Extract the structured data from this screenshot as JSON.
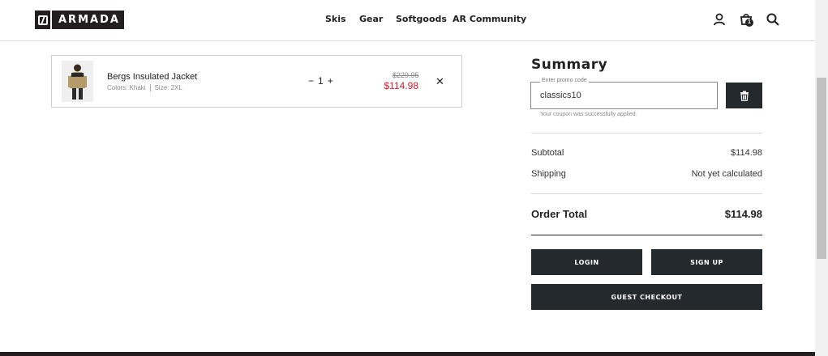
{
  "header": {
    "logo_text": "ARMADA",
    "nav": [
      "Skis",
      "Gear",
      "Softgoods",
      "AR Community"
    ],
    "cart_count": "1"
  },
  "cart": {
    "item": {
      "name": "Bergs Insulated Jacket",
      "color": "Colors: Khaki",
      "size": "Size: 2XL",
      "quantity": "1",
      "decrement": "−",
      "increment": "+",
      "original_price": "$229.95",
      "sale_price": "$114.98",
      "remove": "✕"
    }
  },
  "summary": {
    "title": "Summary",
    "promo_label": "Enter promo code",
    "promo_value": "classics10",
    "coupon_message": "Your coupon was successfully applied.",
    "subtotal_label": "Subtotal",
    "subtotal_value": "$114.98",
    "shipping_label": "Shipping",
    "shipping_value": "Not yet calculated",
    "total_label": "Order Total",
    "total_value": "$114.98",
    "login_label": "LOGIN",
    "signup_label": "SIGN UP",
    "guest_label": "GUEST CHECKOUT"
  },
  "colors": {
    "dark": "#24292d",
    "sale_red": "#c8202f"
  },
  "icons": [
    "user-icon",
    "cart-icon",
    "search-icon",
    "trash-icon",
    "close-icon"
  ]
}
